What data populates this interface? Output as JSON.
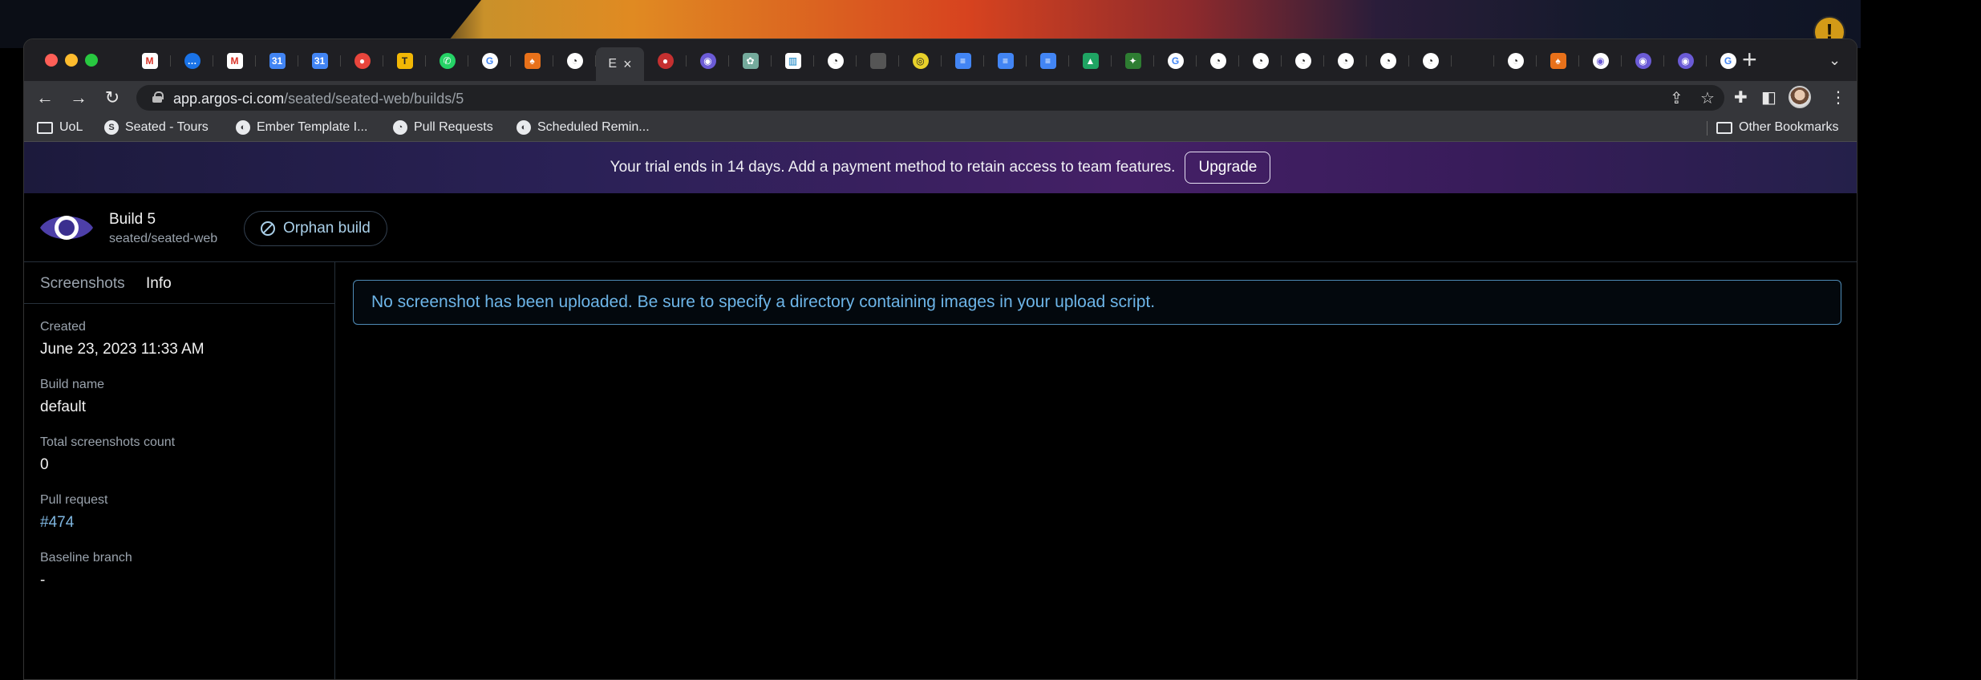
{
  "browser": {
    "active_tab_title": "E",
    "url_host": "app.argos-ci.com",
    "url_path": "/seated/seated-web/builds/5",
    "bookmarks": [
      {
        "label": "UoL",
        "icon": "folder-icon"
      },
      {
        "label": "Seated - Tours",
        "icon": "seated-icon"
      },
      {
        "label": "Ember Template I...",
        "icon": "globe-icon"
      },
      {
        "label": "Pull Requests",
        "icon": "github-icon"
      },
      {
        "label": "Scheduled Remin...",
        "icon": "globe-icon"
      }
    ],
    "other_bookmarks": "Other Bookmarks"
  },
  "banner": {
    "text": "Your trial ends in 14 days. Add a payment method to retain access to team features.",
    "upgrade_label": "Upgrade",
    "colors": {
      "start": "#1c1a3c",
      "mid": "#442066",
      "end": "#24204a"
    }
  },
  "build": {
    "title": "Build 5",
    "repo": "seated/seated-web",
    "badge_label": "Orphan build"
  },
  "sidebar": {
    "tabs": [
      "Screenshots",
      "Info"
    ],
    "active_tab": "Info",
    "info": [
      {
        "label": "Created",
        "value": "June 23, 2023 11:33 AM"
      },
      {
        "label": "Build name",
        "value": "default"
      },
      {
        "label": "Total screenshots count",
        "value": "0"
      },
      {
        "label": "Pull request",
        "value": "#474"
      },
      {
        "label": "Baseline branch",
        "value": "-"
      }
    ]
  },
  "main": {
    "notice": "No screenshot has been uploaded. Be sure to specify a directory containing images in your upload script."
  },
  "system": {
    "notification_glyph": "!"
  }
}
